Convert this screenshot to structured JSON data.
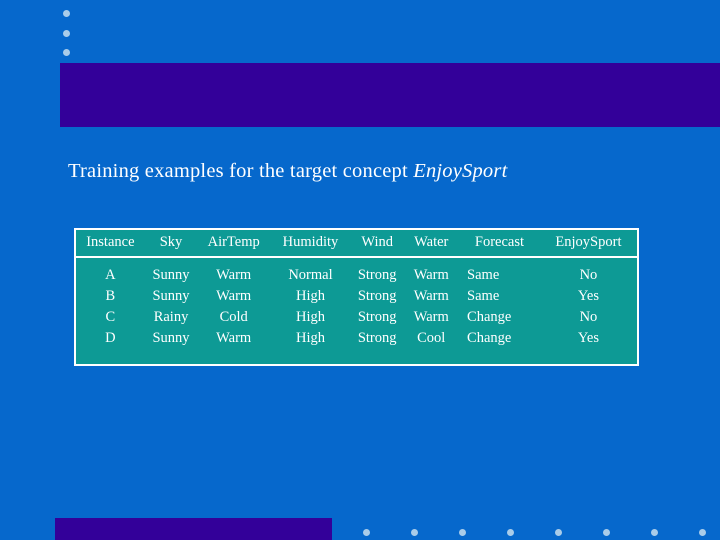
{
  "slide": {
    "title_plain": "Training examples for the target concept ",
    "title_emphasis": "EnjoySport",
    "background_color": "#0668cc",
    "band_color": "#330099",
    "table_color": "#0d9a95",
    "accent_dot_color": "#a9cce9"
  },
  "decorations": {
    "top_bullets": [
      "bullet-1",
      "bullet-2",
      "bullet-3"
    ],
    "footer_dots": [
      "dot-1",
      "dot-2",
      "dot-3",
      "dot-4",
      "dot-5",
      "dot-6",
      "dot-7",
      "dot-8"
    ]
  },
  "table": {
    "headers": [
      "Instance",
      "Sky",
      "AirTemp",
      "Humidity",
      "Wind",
      "Water",
      "Forecast",
      "EnjoySport"
    ],
    "rows": [
      {
        "instance": "A",
        "sky": "Sunny",
        "airtemp": "Warm",
        "humidity": "Normal",
        "wind": "Strong",
        "water": "Warm",
        "forecast": "Same",
        "enjoysport": "No"
      },
      {
        "instance": "B",
        "sky": "Sunny",
        "airtemp": "Warm",
        "humidity": "High",
        "wind": "Strong",
        "water": "Warm",
        "forecast": "Same",
        "enjoysport": "Yes"
      },
      {
        "instance": "C",
        "sky": "Rainy",
        "airtemp": "Cold",
        "humidity": "High",
        "wind": "Strong",
        "water": "Warm",
        "forecast": "Change",
        "enjoysport": "No"
      },
      {
        "instance": "D",
        "sky": "Sunny",
        "airtemp": "Warm",
        "humidity": "High",
        "wind": "Strong",
        "water": "Cool",
        "forecast": "Change",
        "enjoysport": "Yes"
      }
    ]
  }
}
